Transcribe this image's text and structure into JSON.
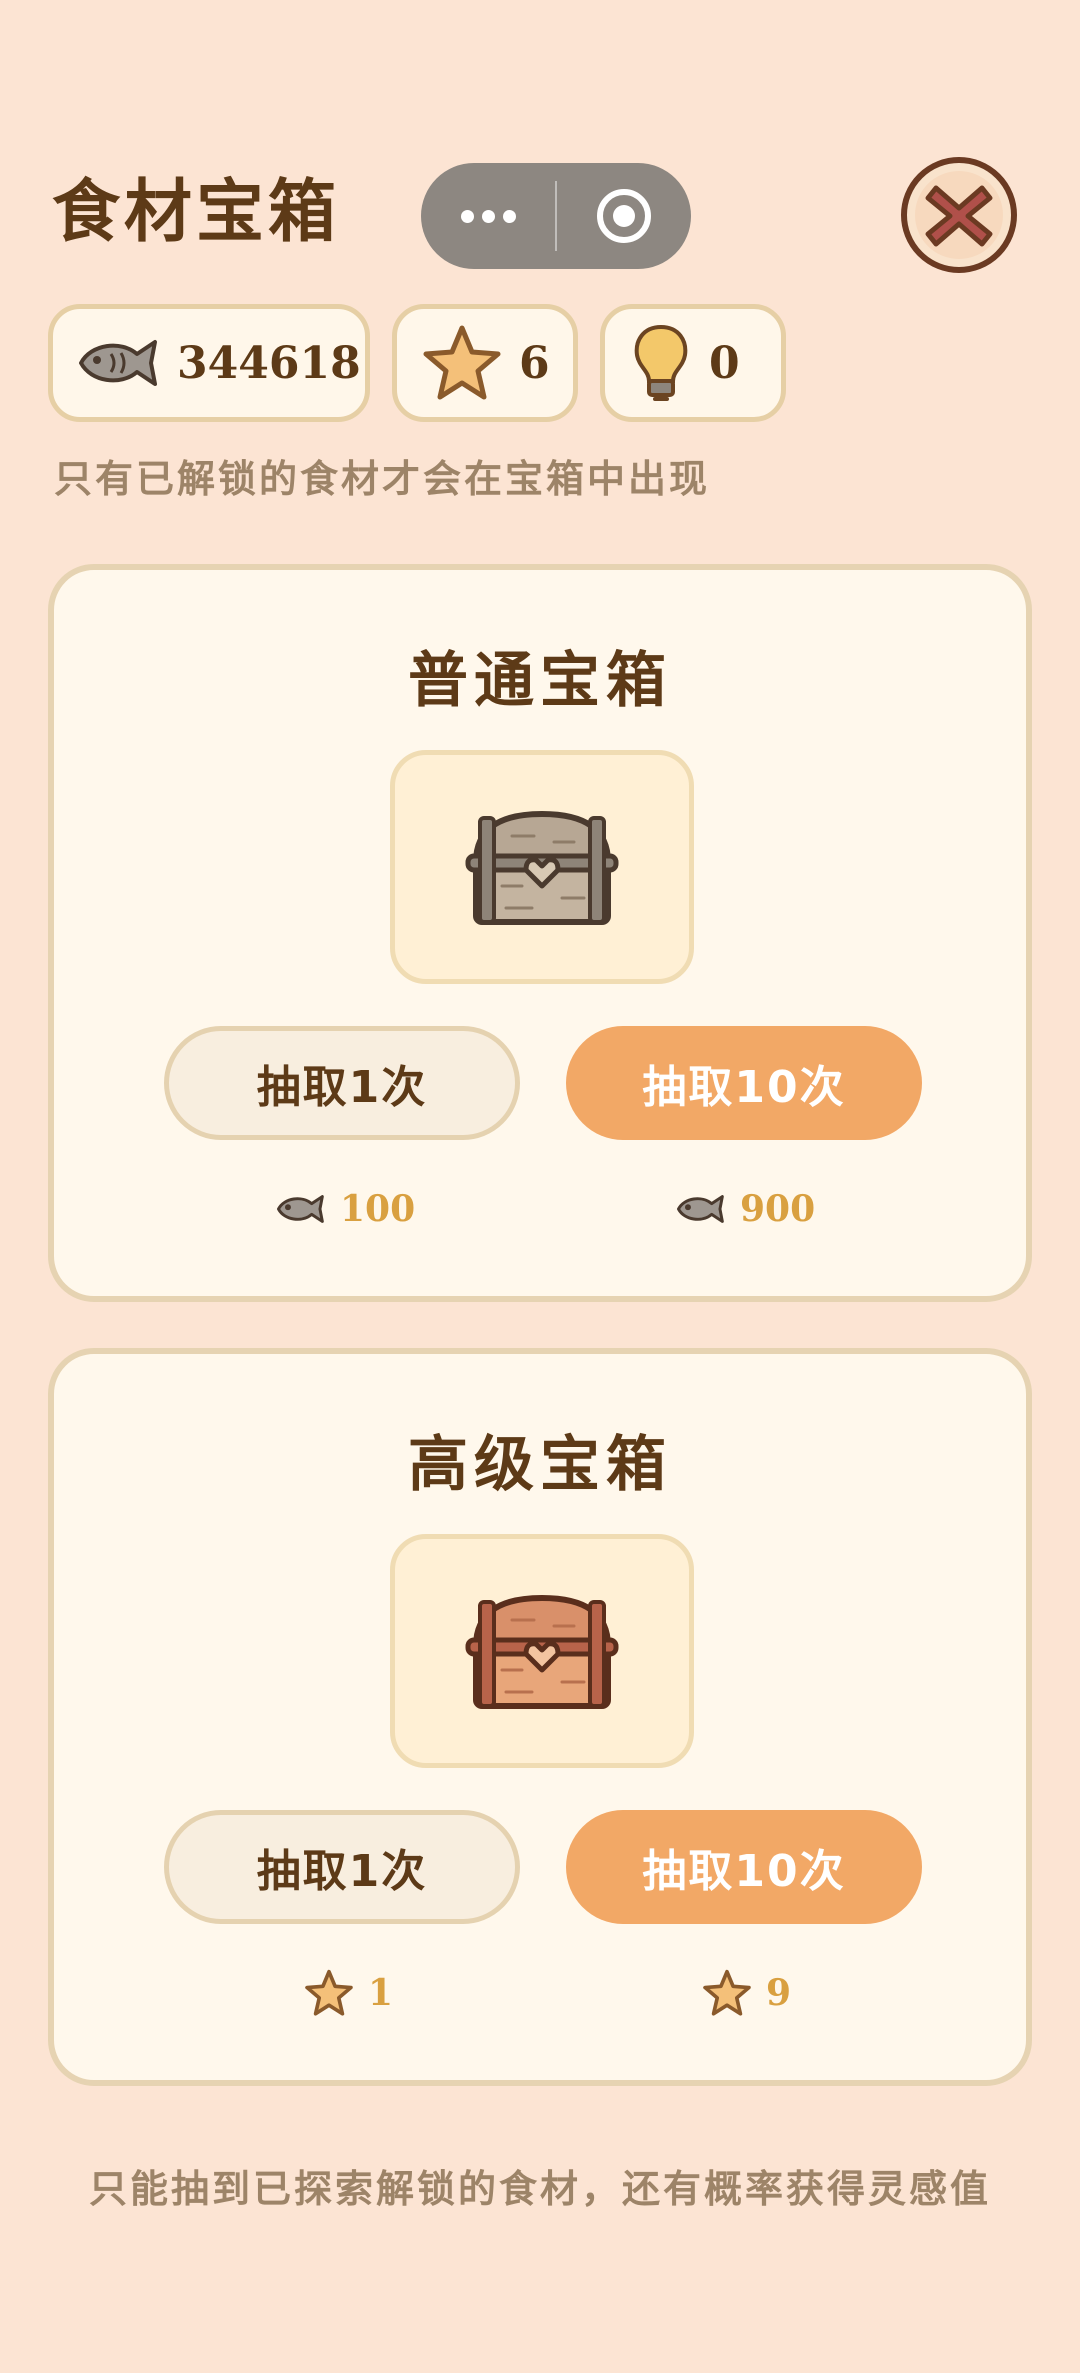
{
  "header": {
    "title": "食材宝箱"
  },
  "currencies": {
    "fish": "344618",
    "star": "6",
    "bulb": "0"
  },
  "hint": "只有已解锁的食材才会在宝箱中出现",
  "cards": [
    {
      "title": "普通宝箱",
      "draw_one_label": "抽取1次",
      "draw_ten_label": "抽取10次",
      "cost_one": "100",
      "cost_ten": "900",
      "cost_icon": "fish-icon"
    },
    {
      "title": "高级宝箱",
      "draw_one_label": "抽取1次",
      "draw_ten_label": "抽取10次",
      "cost_one": "1",
      "cost_ten": "9",
      "cost_icon": "star-icon"
    }
  ],
  "footer": "只能抽到已探索解锁的食材，还有概率获得灵感值",
  "colors": {
    "background": "#fce4d3",
    "accent_button": "#f2a866",
    "title_text": "#5d3a17"
  }
}
